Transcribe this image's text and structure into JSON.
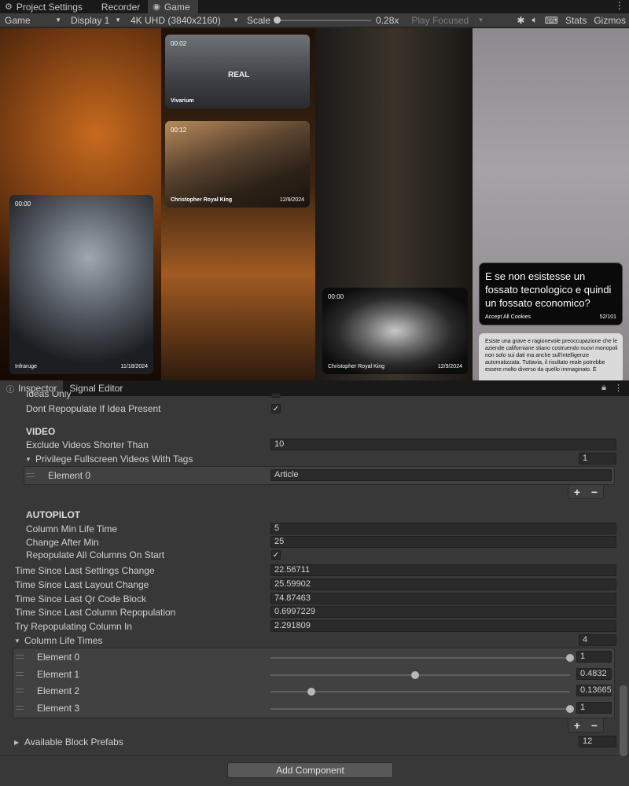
{
  "tabs": [
    {
      "label": "Project Settings",
      "icon": "gear-icon"
    },
    {
      "label": "Recorder",
      "icon": ""
    },
    {
      "label": "Game",
      "icon": "gamepad-icon"
    }
  ],
  "game_toolbar": {
    "mode": "Game",
    "display": "Display 1",
    "resolution": "4K UHD (3840x2160)",
    "scale_label": "Scale",
    "scale_value": "0.28x",
    "scale_fraction": 0.0,
    "play_focused": "Play Focused",
    "stats": "Stats",
    "gizmos": "Gizmos"
  },
  "cards": {
    "c1": {
      "time": "00:02",
      "title": "Vivarium",
      "date": "",
      "poster": "REAL"
    },
    "c2": {
      "time": "00:12",
      "title": "Christopher Royal King",
      "date": "12/9/2024"
    },
    "c3": {
      "time": "00:00",
      "title": "Infraruge",
      "date": "11/18/2024"
    },
    "c4": {
      "time": "00:00",
      "title": "Christopher Royal King",
      "date": "12/9/2024"
    }
  },
  "question_card": {
    "text": "E se non esistesse un fossato tecnologico e quindi un fossato economico?",
    "cookies": "Accept All Cookies",
    "count": "52/101"
  },
  "text_card": {
    "text": "Esiste una grave e ragionevole preoccupazione che le aziende californiane stiano costruendo nuovi monopoli non solo sui dati ma anche sull'intelligenze automatizzata. Tuttavia, il risultato reale potrebbe essere molto diverso da quello immaginato. È"
  },
  "inspector_tabs": [
    {
      "label": "Inspector",
      "icon": "info-icon"
    },
    {
      "label": "Signal Editor",
      "icon": ""
    }
  ],
  "inspector": {
    "ideas_only": "Ideas Only",
    "dont_repopulate": "Dont Repopulate If Idea Present",
    "video_header": "VIDEO",
    "exclude_videos": "Exclude Videos Shorter Than",
    "exclude_value": "10",
    "privilege": "Privilege Fullscreen Videos With Tags",
    "privilege_count": "1",
    "element0_label": "Element 0",
    "element0_value": "Article",
    "autopilot_header": "AUTOPILOT",
    "column_min": "Column Min Life Time",
    "column_min_value": "5",
    "change_after": "Change After Min",
    "change_after_value": "25",
    "repopulate_all": "Repopulate All Columns On Start",
    "time_settings": "Time Since Last Settings Change",
    "time_settings_value": "22.56711",
    "time_layout": "Time Since Last Layout Change",
    "time_layout_value": "25.59902",
    "time_qr": "Time Since Last Qr Code Block",
    "time_qr_value": "74.87463",
    "time_column": "Time Since Last Column Repopulation",
    "time_column_value": "0.6997229",
    "try_repop": "Try Repopulating Column In",
    "try_repop_value": "2.291809",
    "column_life": "Column Life Times",
    "column_life_count": "4",
    "life_elements": [
      {
        "label": "Element 0",
        "value": "1",
        "level": 1.0
      },
      {
        "label": "Element 1",
        "value": "0.4832",
        "level": 0.4832
      },
      {
        "label": "Element 2",
        "value": "0.13665",
        "level": 0.13665
      },
      {
        "label": "Element 3",
        "value": "1",
        "level": 1.0
      }
    ],
    "available_blocks": "Available Block Prefabs",
    "available_blocks_count": "12",
    "add_component": "Add Component"
  }
}
